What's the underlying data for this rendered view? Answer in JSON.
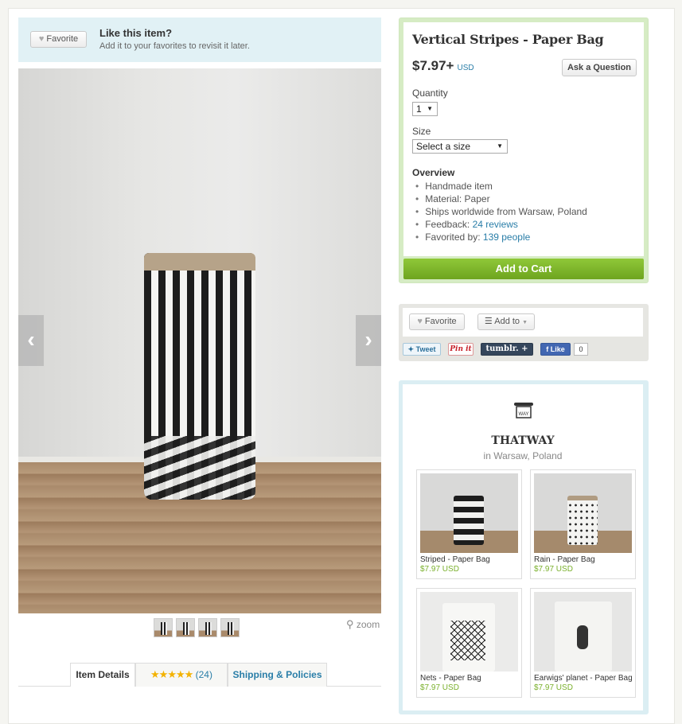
{
  "favorite_banner": {
    "button_label": "Favorite",
    "title": "Like this item?",
    "subtitle": "Add it to your favorites to revisit it later."
  },
  "gallery": {
    "zoom_label": "zoom",
    "thumbnail_count": 4
  },
  "tabs": [
    {
      "label": "Item Details"
    },
    {
      "label": "(24)"
    },
    {
      "label": "Shipping & Policies"
    }
  ],
  "rating_stars": "★★★★★",
  "product": {
    "title": "Vertical Stripes - Paper Bag",
    "price": "$7.97+",
    "currency": "USD",
    "ask_label": "Ask a Question",
    "quantity_label": "Quantity",
    "quantity_value": "1",
    "size_label": "Size",
    "size_value": "Select a size",
    "overview_title": "Overview",
    "overview": {
      "handmade": "Handmade item",
      "material": "Material: Paper",
      "ships": "Ships worldwide from Warsaw, Poland",
      "feedback_prefix": "Feedback: ",
      "feedback_link": "24 reviews",
      "favorited_prefix": "Favorited by: ",
      "favorited_link": "139 people"
    },
    "add_to_cart": "Add to Cart"
  },
  "social": {
    "favorite_label": "Favorite",
    "addto_label": "Add to",
    "tweet": "Tweet",
    "pinit": "Pin it",
    "tumblr": "tumblr. +",
    "fb_like": "Like",
    "fb_count": "0"
  },
  "shop": {
    "name": "THATWAY",
    "location": "in Warsaw, Poland",
    "items": [
      {
        "name": "Striped - Paper Bag",
        "price": "$7.97 USD"
      },
      {
        "name": "Rain - Paper Bag",
        "price": "$7.97 USD"
      },
      {
        "name": "Nets - Paper Bag",
        "price": "$7.97 USD"
      },
      {
        "name": "Earwigs' planet - Paper Bag",
        "price": "$7.97 USD"
      }
    ]
  },
  "colors": {
    "accent_link": "#2a7ea8",
    "cart_green": "#7ab02c",
    "star": "#f3b200"
  }
}
